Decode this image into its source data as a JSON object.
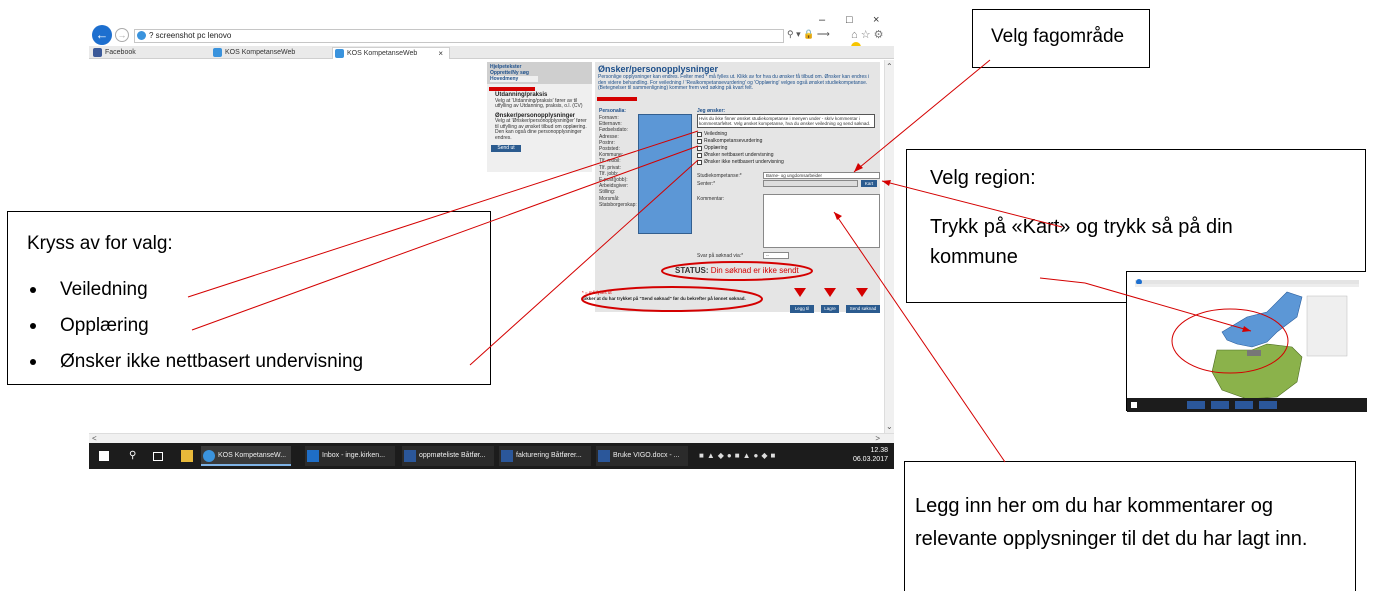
{
  "browser": {
    "address": "? screenshot pc lenovo",
    "tabs": [
      "Facebook",
      "KOS KompetanseWeb",
      "KOS KompetanseWeb"
    ],
    "tab_close": "×",
    "window_controls": [
      "–",
      "□",
      "×"
    ]
  },
  "kos": {
    "left_header": [
      "Hjelpetekster",
      "Opprette/Ny søg",
      "Hovedmeny"
    ],
    "left_items": [
      {
        "title": "Utdanning/praksis",
        "text": "Velg at 'Utdanning/praksis' fører av til utfylling av Utdanning, praksis, o.l. (CV)"
      },
      {
        "title": "Ønsker/personopplysninger",
        "text": "Velg at 'Ønsker/personopplysninger' fører til utfylling av ønsket tilbud om opplæring. Den kan også dine personopplysninger endres."
      }
    ],
    "left_button": "Send ut",
    "title": "Ønsker/personopplysninger",
    "intro": "Personlige opplysninger kan endres. Felter med * må fylles ut. Klikk av for hva du ønsker få tilbud om. Ønsker kan endres i den videre behandling. For veiledning / 'Realkompetansevurdering' og 'Opplæring' velges også ønsket studiekompetanse. (Betegnelser til sammenligning) kommer frem ved søking på kvart felt.",
    "personalia_label": "Personalia:",
    "personalia_fields": [
      "Fornavn:",
      "Etternavn:",
      "Fødselsdato:",
      "Adresse:",
      "Postnr:",
      "Poststed:",
      "Kommune:",
      "Tlf. mobil:",
      "Tlf. privat:",
      "Tlf. jobb:",
      "E-post(jobb):",
      "Arbeidsgiver:",
      "Stilling:",
      "Morsmål:",
      "Statsborgerskap:"
    ],
    "onsker_label": "Jeg ønsker:",
    "onsker_box": "Hvis du ikke finner ønsket studiekompetanse i menyen under - skriv kommentar i kommentarfeltet. Velg ønsket kompetanse, hva du ønsker veiledning og send søknad.",
    "checkboxes": [
      "Veiledning",
      "Realkompetansevurdering",
      "Opplæring",
      "Ønsker nettbasert undervisning",
      "Ønsker ikke nettbasert undervisning"
    ],
    "studie_label": "Studiekompetanse:*",
    "studie_value": "Barne- og ungdomsarbeider",
    "senter_label": "Senter:*",
    "kart_button": "Kart",
    "kommentar_label": "Kommentar:",
    "svar_label": "Svar på søknad via:*",
    "svar_value": "--",
    "status_label": "STATUS:",
    "status_value": "Din søknad er ikke sendt",
    "required_note": "* = må fylles ut",
    "footer_note": "Sikker at du har trykket på \"Send søknad\" før du bekrefter på lønnet søknad.",
    "buttons": [
      "Legg til",
      "Lagre",
      "Send søknad"
    ]
  },
  "taskbar": {
    "apps": [
      "KOS KompetanseW...",
      "Inbox - inge.kirken...",
      "oppmøteliste Båtfør...",
      "fakturering Båtfører...",
      "Bruke VIGO.docx - ..."
    ],
    "time": "12.38",
    "date": "06.03.2017"
  },
  "annotations": {
    "fagomrade": "Velg fagområde",
    "region_title": "Velg region:",
    "region_text": "Trykk på «Kart» og trykk så på din kommune",
    "kryss_title": "Kryss av for valg:",
    "kryss_items": [
      "Veiledning",
      "Opplæring",
      "Ønsker ikke nettbasert undervisning"
    ],
    "kommentar": "Legg inn her om du har kommentarer og relevante opplysninger til det du har lagt inn."
  },
  "colors": {
    "accent_red": "#d40000",
    "kos_blue": "#1d4f8a",
    "map_blue": "#5c97d6",
    "map_green": "#8bb24b"
  }
}
